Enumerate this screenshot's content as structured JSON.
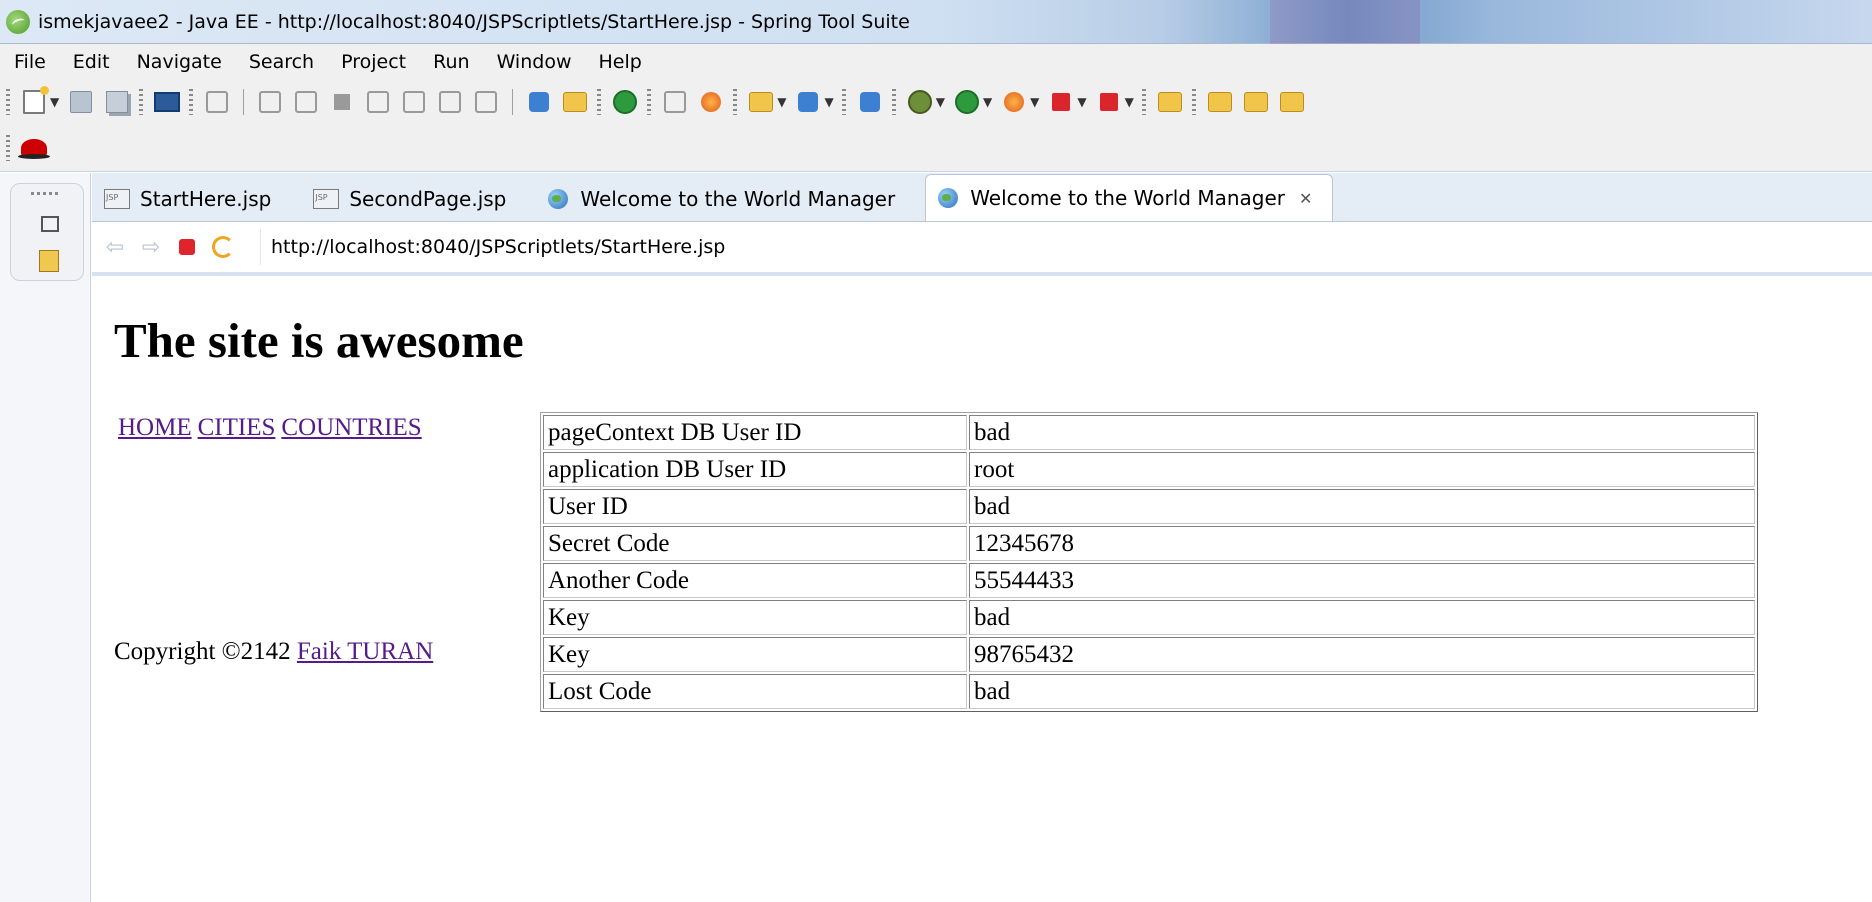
{
  "window": {
    "title": "ismekjavaee2 - Java EE - http://localhost:8040/JSPScriptlets/StartHere.jsp - Spring Tool Suite"
  },
  "menu": [
    "File",
    "Edit",
    "Navigate",
    "Search",
    "Project",
    "Run",
    "Window",
    "Help"
  ],
  "tabs": [
    {
      "label": "StartHere.jsp",
      "icon": "jsp-file-icon",
      "active": false
    },
    {
      "label": "SecondPage.jsp",
      "icon": "jsp-file-icon",
      "active": false
    },
    {
      "label": "Welcome to the World Manager",
      "icon": "globe-icon",
      "active": false
    },
    {
      "label": "Welcome to the World Manager",
      "icon": "globe-icon",
      "active": true
    }
  ],
  "tab_close_glyph": "✕",
  "browser": {
    "url": "http://localhost:8040/JSPScriptlets/StartHere.jsp"
  },
  "page": {
    "heading": "The site is awesome",
    "links": [
      "HOME",
      "CITIES",
      "COUNTRIES"
    ],
    "table": [
      {
        "key": "pageContext DB User ID",
        "value": "bad"
      },
      {
        "key": "application DB User ID",
        "value": "root"
      },
      {
        "key": "User ID",
        "value": "bad"
      },
      {
        "key": "Secret Code",
        "value": "12345678"
      },
      {
        "key": "Another Code",
        "value": "55544433"
      },
      {
        "key": "Key",
        "value": "bad"
      },
      {
        "key": "Key",
        "value": "98765432"
      },
      {
        "key": "Lost Code",
        "value": "bad"
      }
    ],
    "footer_text": "Copyright ©2142 ",
    "footer_link": "Faik TURAN"
  },
  "colors": {
    "visited_link": "#551a8b",
    "tab_bar": "#e4ecf6",
    "stop_red": "#e0242b"
  }
}
